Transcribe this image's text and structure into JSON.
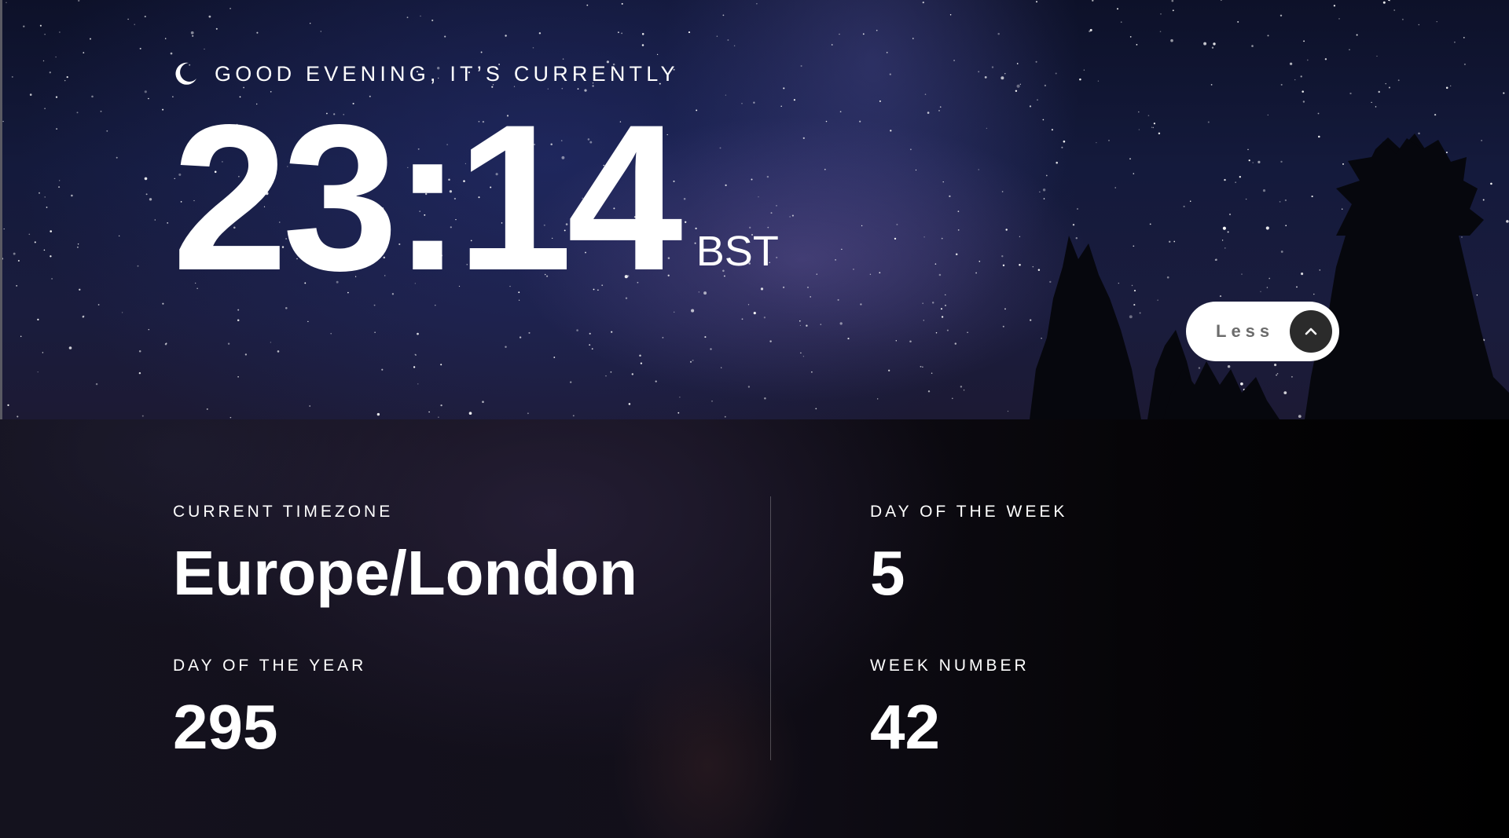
{
  "greeting": {
    "icon": "moon-icon",
    "text": "Good evening, it’s currently"
  },
  "clock": {
    "time": "23:14",
    "abbreviation": "BST"
  },
  "toggle": {
    "label": "Less",
    "icon": "chevron-up-icon"
  },
  "details": {
    "timezone": {
      "label": "Current timezone",
      "value": "Europe/London"
    },
    "day_of_year": {
      "label": "Day of the year",
      "value": "295"
    },
    "day_of_week": {
      "label": "Day of the week",
      "value": "5"
    },
    "week_number": {
      "label": "Week number",
      "value": "42"
    }
  },
  "colors": {
    "sky": "#141a3c",
    "panel": "#120f1a",
    "text": "#ffffff",
    "toggle_bg": "#ffffff",
    "toggle_label": "#6c6c6c",
    "toggle_circle": "#2b2b2b"
  }
}
